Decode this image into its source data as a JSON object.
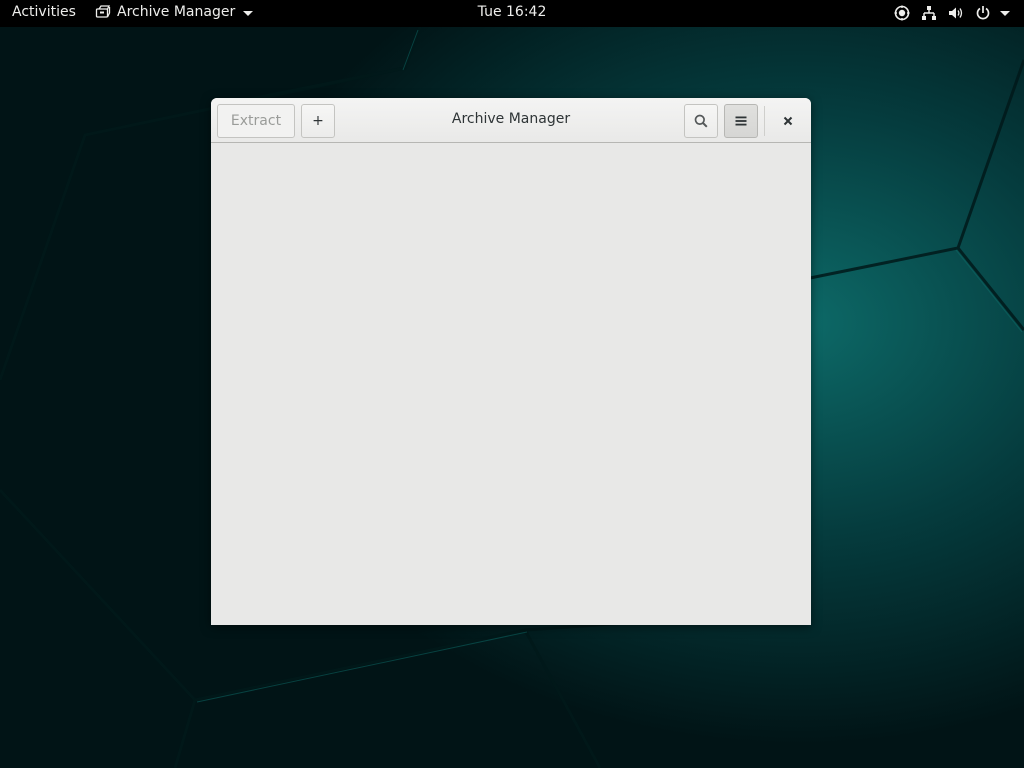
{
  "topbar": {
    "activities_label": "Activities",
    "app_menu_label": "Archive Manager",
    "clock": "Tue 16:42",
    "status_icons": [
      "accessibility-icon",
      "network-wired-icon",
      "volume-icon",
      "power-icon"
    ]
  },
  "window": {
    "title": "Archive Manager",
    "extract_label": "Extract",
    "add_label": "+",
    "search_icon": "search-icon",
    "menu_icon": "hamburger-menu-icon",
    "close_icon": "close-icon"
  },
  "colors": {
    "topbar_bg": "#000000",
    "wallpaper_accent": "#0a5b5b",
    "window_bg": "#e8e8e7"
  }
}
